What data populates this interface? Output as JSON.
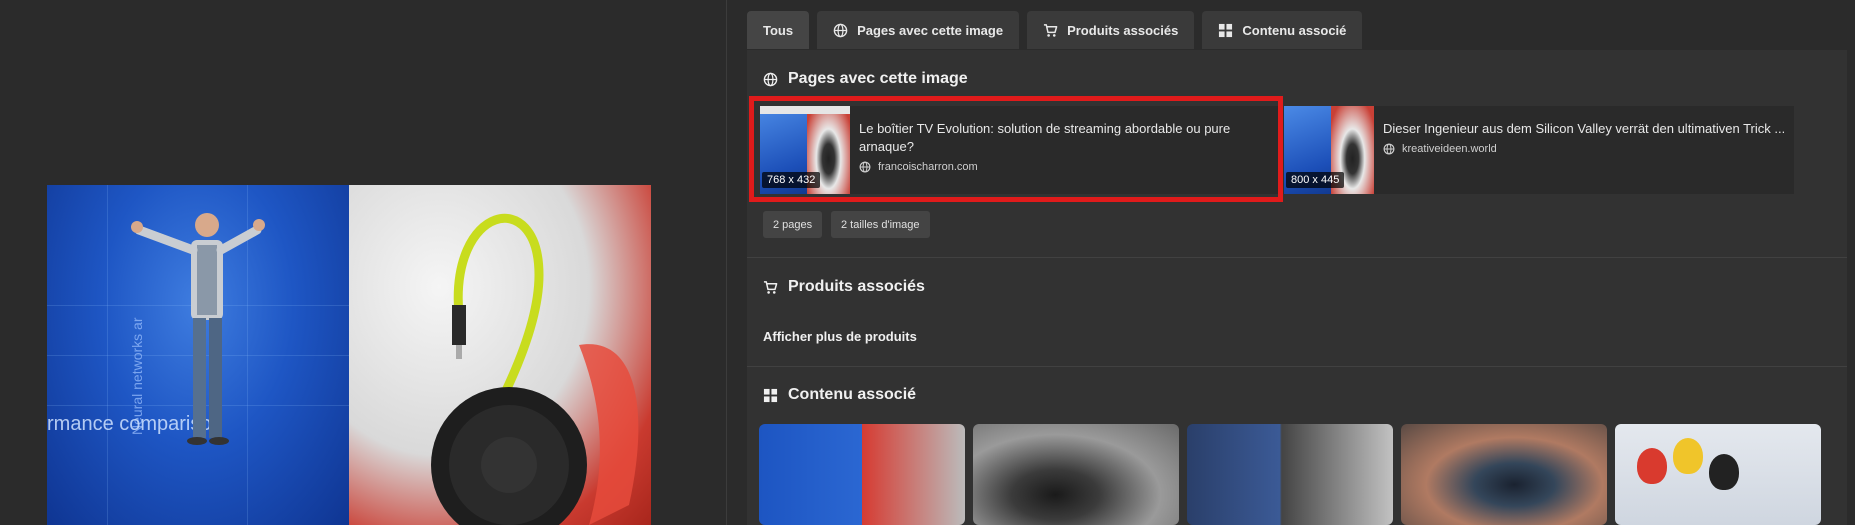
{
  "tabs": [
    {
      "label": "Tous",
      "icon": "",
      "active": true
    },
    {
      "label": "Pages avec cette image",
      "icon": "globe-icon"
    },
    {
      "label": "Produits associés",
      "icon": "cart-icon"
    },
    {
      "label": "Contenu associé",
      "icon": "grid-icon"
    }
  ],
  "sections": {
    "pages": {
      "title": "Pages avec cette image",
      "cards": [
        {
          "title": "Le boîtier TV Evolution: solution de streaming abordable ou pure arnaque?",
          "source": "francoischarron.com",
          "size": "768 x 432"
        },
        {
          "title": "Dieser Ingenieur aus dem Silicon Valley verrät den ultimativen Trick ...",
          "source": "kreativeideen.world",
          "size": "800 x 445"
        }
      ],
      "chips": [
        "2 pages",
        "2 tailles d'image"
      ]
    },
    "products": {
      "title": "Produits associés",
      "more": "Afficher plus de produits"
    },
    "related": {
      "title": "Contenu associé"
    }
  },
  "preview": {
    "stage_text": "rmance compariso",
    "side_text": "Neural networks ar"
  },
  "colors": {
    "background": "#2b2b2b",
    "panel": "#323232",
    "highlight": "#e01b1b"
  }
}
